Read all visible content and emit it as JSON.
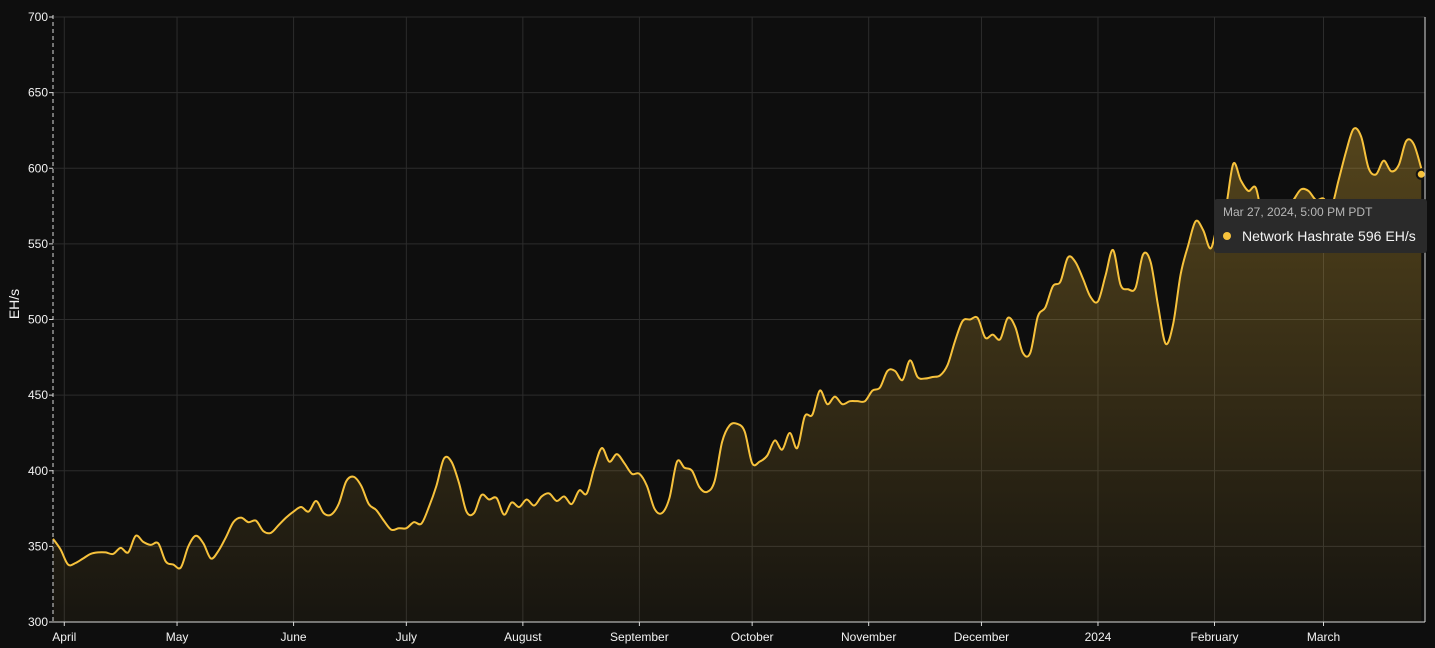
{
  "colors": {
    "background": "#0e0e0e",
    "line": "#f7c23c",
    "grid": "#2c2c2c",
    "axis": "#d9d9d9",
    "tooltip_bg": "#2a2a2a"
  },
  "tooltip": {
    "time": "Mar 27, 2024, 5:00 PM PDT",
    "series": "Network Hashrate",
    "value": "596",
    "unit": "EH/s"
  },
  "chart_data": {
    "type": "area",
    "ylabel": "EH/s",
    "ylim": [
      300,
      700
    ],
    "yticks": [
      300,
      350,
      400,
      450,
      500,
      550,
      600,
      650,
      700
    ],
    "grid": true,
    "x_start": "2023-03-29",
    "x_end": "2024-03-28",
    "xticks": [
      {
        "label": "April",
        "date": "2023-04-01"
      },
      {
        "label": "May",
        "date": "2023-05-01"
      },
      {
        "label": "June",
        "date": "2023-06-01"
      },
      {
        "label": "July",
        "date": "2023-07-01"
      },
      {
        "label": "August",
        "date": "2023-08-01"
      },
      {
        "label": "September",
        "date": "2023-09-01"
      },
      {
        "label": "October",
        "date": "2023-10-01"
      },
      {
        "label": "November",
        "date": "2023-11-01"
      },
      {
        "label": "December",
        "date": "2023-12-01"
      },
      {
        "label": "2024",
        "date": "2024-01-01"
      },
      {
        "label": "February",
        "date": "2024-02-01"
      },
      {
        "label": "March",
        "date": "2024-03-01"
      }
    ],
    "series": [
      {
        "name": "Network Hashrate",
        "points": [
          [
            "2023-03-29",
            355
          ],
          [
            "2023-03-31",
            348
          ],
          [
            "2023-04-02",
            338
          ],
          [
            "2023-04-04",
            339
          ],
          [
            "2023-04-06",
            342
          ],
          [
            "2023-04-08",
            345
          ],
          [
            "2023-04-10",
            346
          ],
          [
            "2023-04-12",
            346
          ],
          [
            "2023-04-14",
            345
          ],
          [
            "2023-04-16",
            349
          ],
          [
            "2023-04-18",
            346
          ],
          [
            "2023-04-20",
            357
          ],
          [
            "2023-04-22",
            353
          ],
          [
            "2023-04-24",
            351
          ],
          [
            "2023-04-26",
            352
          ],
          [
            "2023-04-28",
            340
          ],
          [
            "2023-04-30",
            338
          ],
          [
            "2023-05-02",
            336
          ],
          [
            "2023-05-04",
            350
          ],
          [
            "2023-05-06",
            357
          ],
          [
            "2023-05-08",
            352
          ],
          [
            "2023-05-10",
            342
          ],
          [
            "2023-05-12",
            347
          ],
          [
            "2023-05-14",
            356
          ],
          [
            "2023-05-16",
            366
          ],
          [
            "2023-05-18",
            369
          ],
          [
            "2023-05-20",
            366
          ],
          [
            "2023-05-22",
            367
          ],
          [
            "2023-05-24",
            360
          ],
          [
            "2023-05-26",
            359
          ],
          [
            "2023-05-28",
            364
          ],
          [
            "2023-05-30",
            369
          ],
          [
            "2023-06-01",
            373
          ],
          [
            "2023-06-03",
            376
          ],
          [
            "2023-06-05",
            373
          ],
          [
            "2023-06-07",
            380
          ],
          [
            "2023-06-09",
            372
          ],
          [
            "2023-06-11",
            371
          ],
          [
            "2023-06-13",
            378
          ],
          [
            "2023-06-15",
            393
          ],
          [
            "2023-06-17",
            396
          ],
          [
            "2023-06-19",
            390
          ],
          [
            "2023-06-21",
            378
          ],
          [
            "2023-06-23",
            374
          ],
          [
            "2023-06-25",
            367
          ],
          [
            "2023-06-27",
            361
          ],
          [
            "2023-06-29",
            362
          ],
          [
            "2023-07-01",
            362
          ],
          [
            "2023-07-03",
            366
          ],
          [
            "2023-07-05",
            365
          ],
          [
            "2023-07-07",
            376
          ],
          [
            "2023-07-09",
            390
          ],
          [
            "2023-07-11",
            408
          ],
          [
            "2023-07-13",
            406
          ],
          [
            "2023-07-15",
            392
          ],
          [
            "2023-07-17",
            373
          ],
          [
            "2023-07-19",
            372
          ],
          [
            "2023-07-21",
            384
          ],
          [
            "2023-07-23",
            381
          ],
          [
            "2023-07-25",
            382
          ],
          [
            "2023-07-27",
            371
          ],
          [
            "2023-07-29",
            379
          ],
          [
            "2023-07-31",
            376
          ],
          [
            "2023-08-02",
            381
          ],
          [
            "2023-08-04",
            377
          ],
          [
            "2023-08-06",
            383
          ],
          [
            "2023-08-08",
            385
          ],
          [
            "2023-08-10",
            380
          ],
          [
            "2023-08-12",
            383
          ],
          [
            "2023-08-14",
            378
          ],
          [
            "2023-08-16",
            387
          ],
          [
            "2023-08-18",
            385
          ],
          [
            "2023-08-20",
            402
          ],
          [
            "2023-08-22",
            415
          ],
          [
            "2023-08-24",
            406
          ],
          [
            "2023-08-26",
            411
          ],
          [
            "2023-08-28",
            405
          ],
          [
            "2023-08-30",
            398
          ],
          [
            "2023-09-01",
            398
          ],
          [
            "2023-09-03",
            390
          ],
          [
            "2023-09-05",
            375
          ],
          [
            "2023-09-07",
            372
          ],
          [
            "2023-09-09",
            382
          ],
          [
            "2023-09-11",
            406
          ],
          [
            "2023-09-13",
            402
          ],
          [
            "2023-09-15",
            400
          ],
          [
            "2023-09-17",
            389
          ],
          [
            "2023-09-19",
            386
          ],
          [
            "2023-09-21",
            393
          ],
          [
            "2023-09-23",
            419
          ],
          [
            "2023-09-25",
            430
          ],
          [
            "2023-09-27",
            431
          ],
          [
            "2023-09-29",
            426
          ],
          [
            "2023-10-01",
            405
          ],
          [
            "2023-10-03",
            406
          ],
          [
            "2023-10-05",
            410
          ],
          [
            "2023-10-07",
            420
          ],
          [
            "2023-10-09",
            414
          ],
          [
            "2023-10-11",
            425
          ],
          [
            "2023-10-13",
            415
          ],
          [
            "2023-10-15",
            436
          ],
          [
            "2023-10-17",
            437
          ],
          [
            "2023-10-19",
            453
          ],
          [
            "2023-10-21",
            444
          ],
          [
            "2023-10-23",
            449
          ],
          [
            "2023-10-25",
            444
          ],
          [
            "2023-10-27",
            446
          ],
          [
            "2023-10-29",
            446
          ],
          [
            "2023-10-31",
            446
          ],
          [
            "2023-11-02",
            453
          ],
          [
            "2023-11-04",
            455
          ],
          [
            "2023-11-06",
            466
          ],
          [
            "2023-11-08",
            466
          ],
          [
            "2023-11-10",
            460
          ],
          [
            "2023-11-12",
            473
          ],
          [
            "2023-11-14",
            462
          ],
          [
            "2023-11-16",
            461
          ],
          [
            "2023-11-18",
            462
          ],
          [
            "2023-11-20",
            463
          ],
          [
            "2023-11-22",
            470
          ],
          [
            "2023-11-24",
            486
          ],
          [
            "2023-11-26",
            499
          ],
          [
            "2023-11-28",
            500
          ],
          [
            "2023-11-30",
            501
          ],
          [
            "2023-12-02",
            488
          ],
          [
            "2023-12-04",
            490
          ],
          [
            "2023-12-06",
            487
          ],
          [
            "2023-12-08",
            501
          ],
          [
            "2023-12-10",
            495
          ],
          [
            "2023-12-12",
            478
          ],
          [
            "2023-12-14",
            478
          ],
          [
            "2023-12-16",
            502
          ],
          [
            "2023-12-18",
            508
          ],
          [
            "2023-12-20",
            522
          ],
          [
            "2023-12-22",
            525
          ],
          [
            "2023-12-24",
            541
          ],
          [
            "2023-12-26",
            538
          ],
          [
            "2023-12-28",
            527
          ],
          [
            "2023-12-30",
            515
          ],
          [
            "2024-01-01",
            512
          ],
          [
            "2024-01-03",
            529
          ],
          [
            "2024-01-05",
            546
          ],
          [
            "2024-01-07",
            523
          ],
          [
            "2024-01-09",
            520
          ],
          [
            "2024-01-11",
            521
          ],
          [
            "2024-01-13",
            543
          ],
          [
            "2024-01-15",
            538
          ],
          [
            "2024-01-17",
            509
          ],
          [
            "2024-01-19",
            484
          ],
          [
            "2024-01-21",
            497
          ],
          [
            "2024-01-23",
            530
          ],
          [
            "2024-01-25",
            549
          ],
          [
            "2024-01-27",
            565
          ],
          [
            "2024-01-29",
            559
          ],
          [
            "2024-01-31",
            547
          ],
          [
            "2024-02-02",
            565
          ],
          [
            "2024-02-04",
            574
          ],
          [
            "2024-02-06",
            603
          ],
          [
            "2024-02-08",
            592
          ],
          [
            "2024-02-10",
            585
          ],
          [
            "2024-02-12",
            587
          ],
          [
            "2024-02-14",
            566
          ],
          [
            "2024-02-16",
            574
          ],
          [
            "2024-02-18",
            575
          ],
          [
            "2024-02-20",
            573
          ],
          [
            "2024-02-22",
            579
          ],
          [
            "2024-02-24",
            586
          ],
          [
            "2024-02-26",
            585
          ],
          [
            "2024-02-28",
            579
          ],
          [
            "2024-03-01",
            580
          ],
          [
            "2024-03-03",
            574
          ],
          [
            "2024-03-05",
            592
          ],
          [
            "2024-03-07",
            611
          ],
          [
            "2024-03-09",
            626
          ],
          [
            "2024-03-11",
            621
          ],
          [
            "2024-03-13",
            600
          ],
          [
            "2024-03-15",
            596
          ],
          [
            "2024-03-17",
            605
          ],
          [
            "2024-03-19",
            598
          ],
          [
            "2024-03-21",
            602
          ],
          [
            "2024-03-23",
            618
          ],
          [
            "2024-03-25",
            616
          ],
          [
            "2024-03-27",
            600
          ]
        ]
      }
    ],
    "highlight": {
      "date": "2024-03-27",
      "value": 596
    }
  }
}
